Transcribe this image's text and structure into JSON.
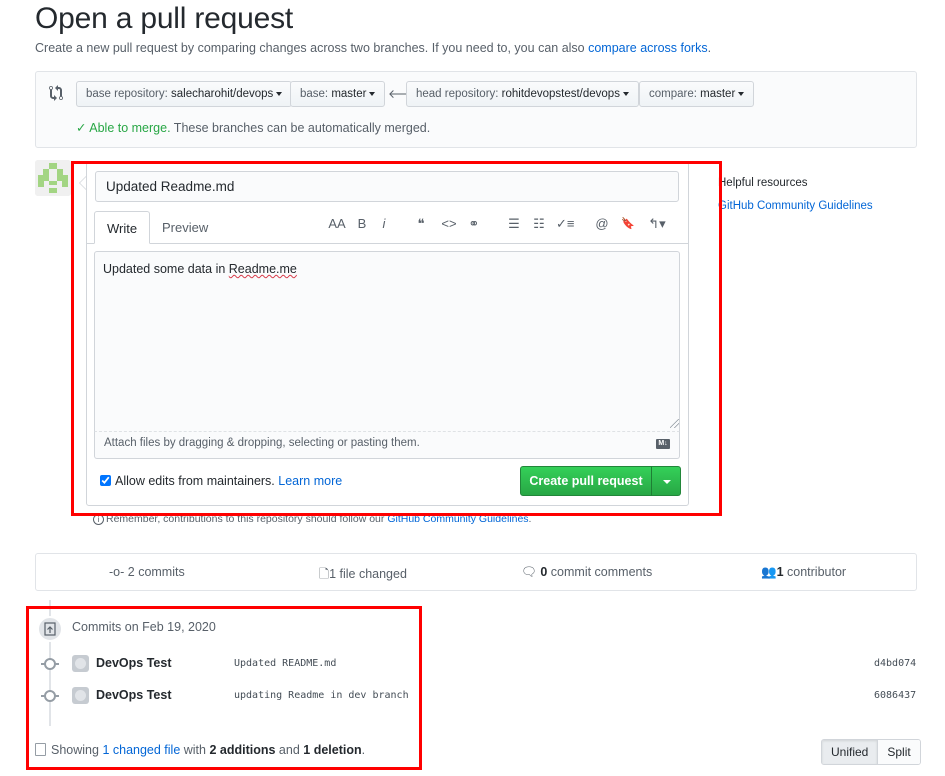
{
  "header": {
    "title": "Open a pull request",
    "subtitle": "Create a new pull request by comparing changes across two branches. If you need to, you can also ",
    "subtitle_link": "compare across forks",
    "subtitle_end": "."
  },
  "compare": {
    "base_repo_label": "base repository: ",
    "base_repo_value": "salecharohit/devops",
    "base_label": "base: ",
    "base_value": "master",
    "head_repo_label": "head repository: ",
    "head_repo_value": "rohitdevopstest/devops",
    "compare_label": "compare: ",
    "compare_value": "master",
    "arrow": "🡐",
    "merge_ok": "✓ Able to merge.",
    "merge_text": " These branches can be automatically merged."
  },
  "form": {
    "title_value": "Updated Readme.md",
    "tabs": [
      {
        "label": "Write",
        "active": true
      },
      {
        "label": "Preview",
        "active": false
      }
    ],
    "toolbar": [
      {
        "name": "header-text-icon",
        "glyph": "AA"
      },
      {
        "name": "bold-icon",
        "glyph": "B"
      },
      {
        "name": "italic-icon",
        "glyph": "i"
      },
      {
        "name": "quote-icon",
        "glyph": "❝"
      },
      {
        "name": "code-icon",
        "glyph": "<>"
      },
      {
        "name": "link-icon",
        "glyph": "⚭"
      },
      {
        "name": "unordered-list-icon",
        "glyph": "☰"
      },
      {
        "name": "ordered-list-icon",
        "glyph": "☷"
      },
      {
        "name": "task-list-icon",
        "glyph": "✓≡"
      },
      {
        "name": "mention-icon",
        "glyph": "@"
      },
      {
        "name": "saved-reply-icon",
        "glyph": "🔖"
      },
      {
        "name": "reply-icon",
        "glyph": "↰▾"
      }
    ],
    "body_prefix": "Updated some data in ",
    "body_misspelled": "Readme.me",
    "attach_text": "Attach files by dragging & dropping, selecting or pasting them.",
    "markdown_icon": "M↓",
    "allow_edits_label": "Allow edits from maintainers.",
    "allow_edits_checked": true,
    "learn_more": "Learn more",
    "create_button": "Create pull request",
    "remember_text": "Remember, contributions to this repository should follow our ",
    "remember_link": "GitHub Community Guidelines",
    "remember_end": "."
  },
  "sidebar": {
    "helpful_title": "Helpful resources",
    "helpful_link": "GitHub Community Guidelines"
  },
  "stats": {
    "commits_count": "2",
    "commits_label": " commits",
    "files_count": "1",
    "files_label": " file changed",
    "comments_count": "0",
    "comments_label": " commit comments",
    "contributors_count": "1",
    "contributors_label": " contributor"
  },
  "commits": {
    "group_title": "Commits on Feb 19, 2020",
    "items": [
      {
        "author": "DevOps Test",
        "message": "Updated README.md",
        "sha": "d4bd074"
      },
      {
        "author": "DevOps Test",
        "message": "updating Readme in dev branch",
        "sha": "6086437"
      }
    ]
  },
  "summary": {
    "prefix": "Showing ",
    "link": "1 changed file",
    "mid": " with ",
    "additions": "2 additions",
    "and": " and ",
    "deletions": "1 deletion",
    "end": "."
  },
  "view_toggle": {
    "unified": "Unified",
    "split": "Split",
    "selected": "Unified"
  },
  "colors": {
    "accent_link": "#0366d6",
    "success": "#28a745",
    "highlight_box": "#ff0000"
  }
}
